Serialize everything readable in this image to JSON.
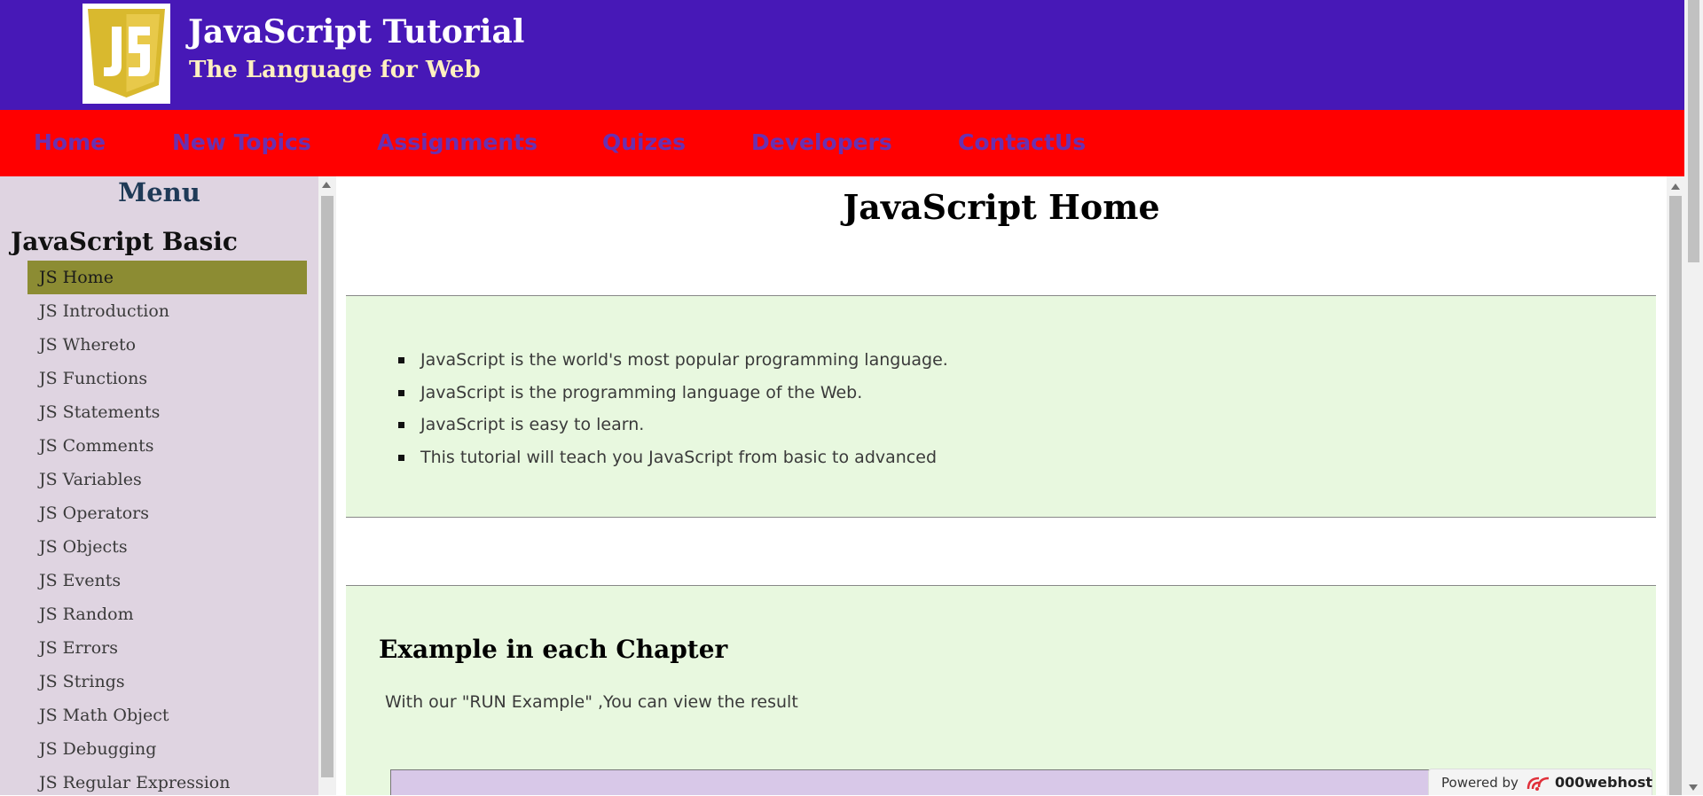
{
  "header": {
    "title": "JavaScript Tutorial",
    "subtitle": "The Language for Web",
    "logo_text": "JS"
  },
  "nav": {
    "items": [
      "Home",
      "New Topics",
      "Assignments",
      "Quizes",
      "Developers",
      "ContactUs"
    ]
  },
  "sidebar": {
    "heading": "Menu",
    "section": "JavaScript Basic",
    "items": [
      {
        "label": "JS Home",
        "active": true
      },
      {
        "label": "JS Introduction"
      },
      {
        "label": "JS Whereto"
      },
      {
        "label": "JS Functions"
      },
      {
        "label": "JS Statements"
      },
      {
        "label": "JS Comments"
      },
      {
        "label": "JS Variables"
      },
      {
        "label": "JS Operators"
      },
      {
        "label": "JS Objects"
      },
      {
        "label": "JS Events"
      },
      {
        "label": "JS Random"
      },
      {
        "label": "JS Errors"
      },
      {
        "label": "JS Strings"
      },
      {
        "label": "JS Math Object"
      },
      {
        "label": "JS Debugging"
      },
      {
        "label": "JS Regular Expression"
      }
    ]
  },
  "main": {
    "title": "JavaScript Home",
    "intro_points": [
      "JavaScript is the world's most popular programming language.",
      "JavaScript is the programming language of the Web.",
      "JavaScript is easy to learn.",
      "This tutorial will teach you JavaScript from basic to advanced"
    ],
    "example_heading": "Example in each Chapter",
    "example_text": "With our \"RUN Example\" ,You can view the result"
  },
  "badge": {
    "powered_label": "Powered by",
    "brand": "000webhost"
  },
  "colors": {
    "header_bg": "#4718b7",
    "nav_bg": "#ff0000",
    "nav_text": "#6a30b0",
    "sidebar_bg": "#dfd4e1",
    "active_item_bg": "#8c8c33",
    "panel_bg": "#e8f8df",
    "logo_yellow": "#d9b92e"
  }
}
